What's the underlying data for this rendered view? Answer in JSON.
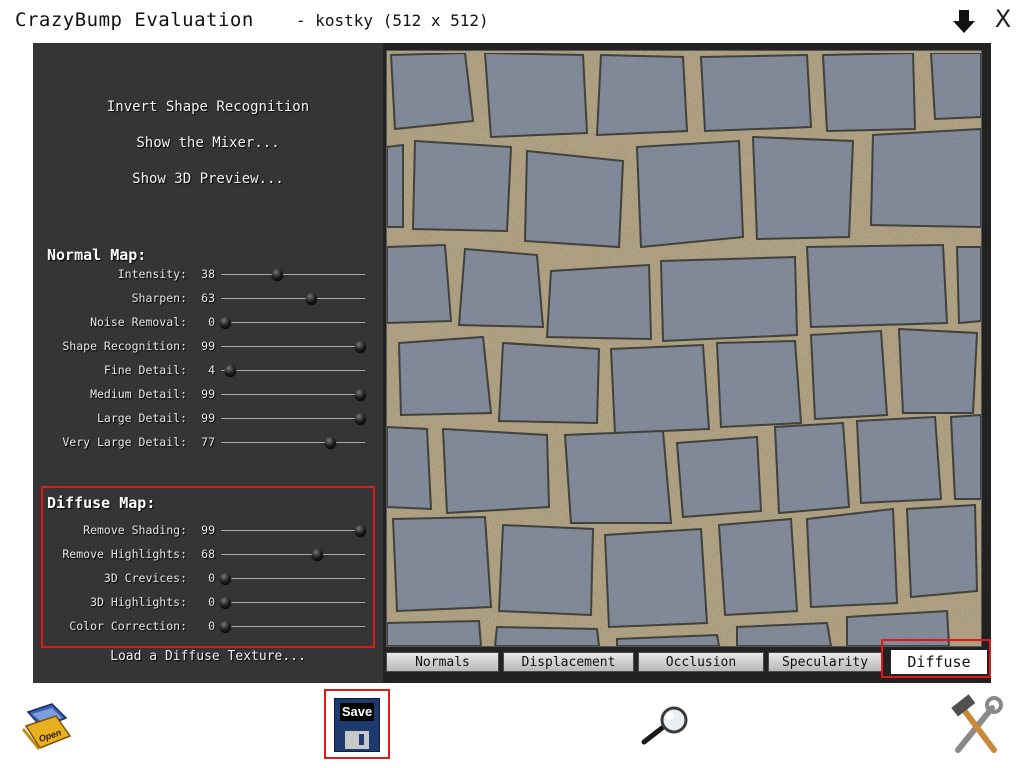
{
  "window": {
    "app_title": "CrazyBump Evaluation",
    "file_title": "- kostky (512 x 512)",
    "minimize_icon": "down-arrow-icon",
    "close_label": "X"
  },
  "options": {
    "invert": "Invert Shape Recognition",
    "mixer": "Show the Mixer...",
    "preview3d": "Show 3D Preview..."
  },
  "normal_map": {
    "title": "Normal Map:",
    "sliders": [
      {
        "label": "Intensity:",
        "value": 38
      },
      {
        "label": "Sharpen:",
        "value": 63
      },
      {
        "label": "Noise Removal:",
        "value": 0
      },
      {
        "label": "Shape Recognition:",
        "value": 99
      },
      {
        "label": "Fine Detail:",
        "value": 4
      },
      {
        "label": "Medium Detail:",
        "value": 99
      },
      {
        "label": "Large Detail:",
        "value": 99
      },
      {
        "label": "Very Large Detail:",
        "value": 77
      }
    ]
  },
  "diffuse_map": {
    "title": "Diffuse Map:",
    "sliders": [
      {
        "label": "Remove Shading:",
        "value": 99
      },
      {
        "label": "Remove Highlights:",
        "value": 68
      },
      {
        "label": "3D Crevices:",
        "value": 0
      },
      {
        "label": "3D Highlights:",
        "value": 0
      },
      {
        "label": "Color Correction:",
        "value": 0
      }
    ],
    "load_texture": "Load a Diffuse Texture..."
  },
  "tabs": {
    "items": [
      {
        "label": "Normals"
      },
      {
        "label": "Displacement"
      },
      {
        "label": "Occlusion"
      },
      {
        "label": "Specularity"
      },
      {
        "label": "Diffuse"
      }
    ],
    "active": "Diffuse"
  },
  "toolbar": {
    "open_label": "Open",
    "save_label": "Save",
    "zoom_icon": "magnifier-icon",
    "tools_icon": "hammer-wrench-icon"
  },
  "colors": {
    "highlight": "#e01818",
    "panel_bg": "#353535",
    "save_blue": "#1d3a6e"
  }
}
